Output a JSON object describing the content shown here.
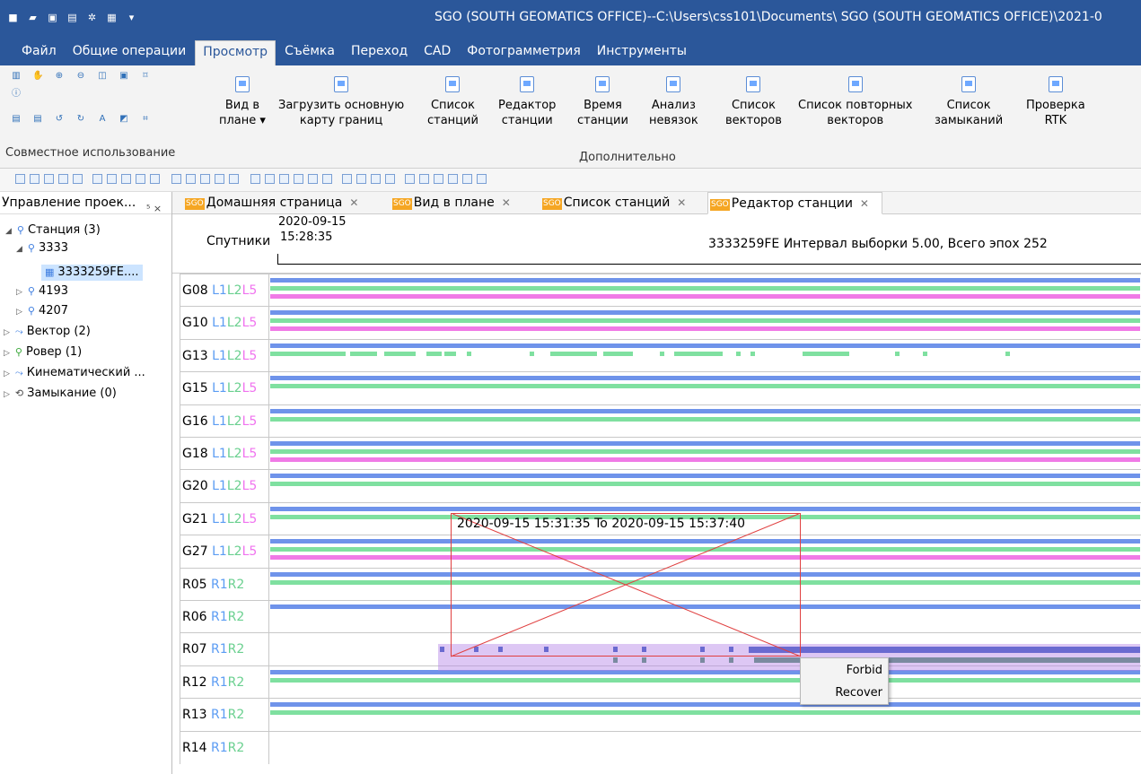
{
  "window": {
    "title": "SGO (SOUTH GEOMATICS OFFICE)--C:\\Users\\css101\\Documents\\ SGO (SOUTH GEOMATICS OFFICE)\\2021-0"
  },
  "menu": {
    "tabs": [
      "Файл",
      "Общие операции",
      "Просмотр",
      "Съёмка",
      "Переход",
      "CAD",
      "Фотограмметрия",
      "Инструменты"
    ],
    "active": "Просмотр"
  },
  "ribbon": {
    "shared_group_label": "Совместное использование",
    "extra_group_label": "Дополнительно",
    "buttons": [
      {
        "l1": "Вид в",
        "l2": "плане ▾"
      },
      {
        "l1": "Загрузить основную",
        "l2": "карту границ"
      },
      {
        "l1": "Список",
        "l2": "станций"
      },
      {
        "l1": "Редактор",
        "l2": "станции"
      },
      {
        "l1": "Время",
        "l2": "станции"
      },
      {
        "l1": "Анализ",
        "l2": "невязок"
      },
      {
        "l1": "Список",
        "l2": "векторов"
      },
      {
        "l1": "Список повторных",
        "l2": "векторов"
      },
      {
        "l1": "Список",
        "l2": "замыканий"
      },
      {
        "l1": "Проверка",
        "l2": "RTK"
      }
    ]
  },
  "left_panel": {
    "title": "Управление проек...",
    "pin": "⁵ ×",
    "tree": [
      {
        "label": "Станция (3)"
      },
      {
        "label": "3333"
      },
      {
        "label": "3333259FE...."
      },
      {
        "label": "4193"
      },
      {
        "label": "4207"
      },
      {
        "label": "Вектор (2)"
      },
      {
        "label": "Ровер (1)"
      },
      {
        "label": "Кинематический ..."
      },
      {
        "label": "Замыкание (0)"
      }
    ]
  },
  "doc_tabs": [
    {
      "label": "Домашняя страница",
      "badge": "SGO"
    },
    {
      "label": "Вид в плане",
      "badge": "SGO"
    },
    {
      "label": "Список станций",
      "badge": "SGO"
    },
    {
      "label": "Редактор станции",
      "badge": "SGO"
    }
  ],
  "editor": {
    "satellites_header": "Спутники",
    "start_date": "2020-09-15",
    "start_time": "15:28:35",
    "info": "3333259FE Интервал выборки 5.00, Всего эпох 252",
    "selection_label": "2020-09-15 15:31:35 To 2020-09-15 15:37:40",
    "rows": [
      {
        "sat": "G08",
        "bands": [
          "L1",
          "L2",
          "L5"
        ]
      },
      {
        "sat": "G10",
        "bands": [
          "L1",
          "L2",
          "L5"
        ]
      },
      {
        "sat": "G13",
        "bands": [
          "L1",
          "L2",
          "L5"
        ]
      },
      {
        "sat": "G15",
        "bands": [
          "L1",
          "L2",
          "L5"
        ]
      },
      {
        "sat": "G16",
        "bands": [
          "L1",
          "L2",
          "L5"
        ]
      },
      {
        "sat": "G18",
        "bands": [
          "L1",
          "L2",
          "L5"
        ]
      },
      {
        "sat": "G20",
        "bands": [
          "L1",
          "L2",
          "L5"
        ]
      },
      {
        "sat": "G21",
        "bands": [
          "L1",
          "L2",
          "L5"
        ]
      },
      {
        "sat": "G27",
        "bands": [
          "L1",
          "L2",
          "L5"
        ]
      },
      {
        "sat": "R05",
        "bands": [
          "R1",
          "R2"
        ]
      },
      {
        "sat": "R06",
        "bands": [
          "R1",
          "R2"
        ]
      },
      {
        "sat": "R07",
        "bands": [
          "R1",
          "R2"
        ]
      },
      {
        "sat": "R12",
        "bands": [
          "R1",
          "R2"
        ]
      },
      {
        "sat": "R13",
        "bands": [
          "R1",
          "R2"
        ]
      },
      {
        "sat": "R14",
        "bands": [
          "R1",
          "R2"
        ]
      }
    ]
  },
  "context_menu": {
    "items": [
      "Forbid",
      "Recover"
    ]
  },
  "colors": {
    "title_bar": "#2b579a",
    "L1": "#6f93ea",
    "L2": "#7fe0a0",
    "L5": "#f07ae6",
    "selection": "#e04040"
  }
}
